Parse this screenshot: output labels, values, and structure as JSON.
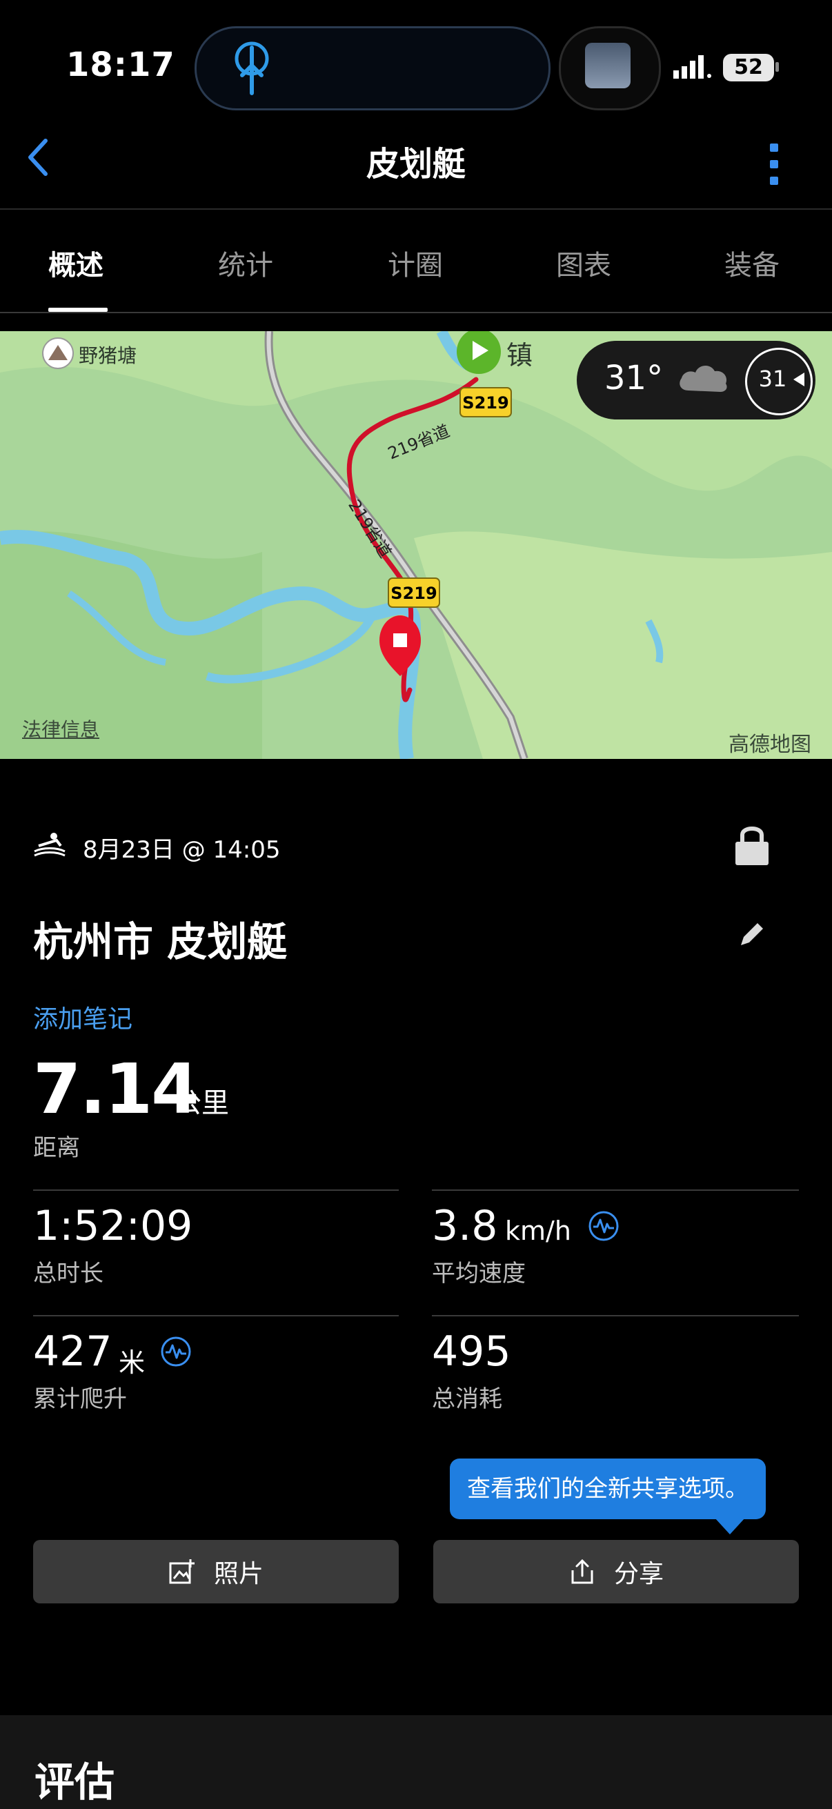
{
  "status_bar": {
    "time": "18:17",
    "battery": "52"
  },
  "header": {
    "title": "皮划艇"
  },
  "tabs": [
    {
      "label": "概述"
    },
    {
      "label": "统计"
    },
    {
      "label": "计圈"
    },
    {
      "label": "图表"
    },
    {
      "label": "装备"
    }
  ],
  "map": {
    "poi": "野猪塘",
    "town": "镇",
    "road_badge": "S219",
    "road_name": "219省道",
    "legal": "法律信息",
    "provider": "高德地图",
    "weather_temp": "31°",
    "weather_circle": "31"
  },
  "activity": {
    "datetime": "8月23日 @ 14:05",
    "name": "杭州市 皮划艇",
    "add_note": "添加笔记",
    "distance": {
      "value": "7.14",
      "unit": "公里",
      "label": "距离"
    }
  },
  "stats": [
    {
      "value": "1:52:09",
      "unit": "",
      "label": "总时长"
    },
    {
      "value": "3.8",
      "unit": "km/h",
      "label": "平均速度"
    },
    {
      "value": "427",
      "unit": "米",
      "label": "累计爬升"
    },
    {
      "value": "495",
      "unit": "",
      "label": "总消耗"
    }
  ],
  "tooltip": "查看我们的全新共享选项。",
  "buttons": {
    "photos": "照片",
    "share": "分享"
  },
  "section": {
    "evaluation": "评估"
  },
  "colors": {
    "accent": "#4a9ff0",
    "route": "#d0102a",
    "map_green": "#a7d59a"
  }
}
